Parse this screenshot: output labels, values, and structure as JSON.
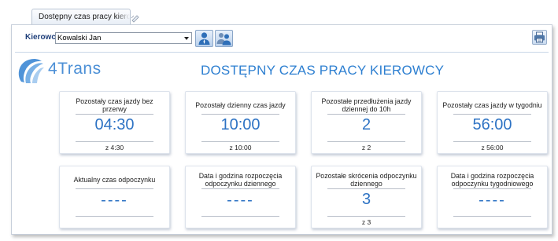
{
  "tab": {
    "label": "Dostępny czas pracy kierowcy"
  },
  "toolbar": {
    "driver_label": "Kierowca",
    "driver_value": "Kowalski Jan"
  },
  "brand": {
    "name": "4Trans"
  },
  "page": {
    "title": "DOSTĘPNY CZAS PRACY KIEROWCY"
  },
  "cards": [
    {
      "label": "Pozostały czas jazdy bez przerwy",
      "value": "04:30",
      "sub": "z 4:30"
    },
    {
      "label": "Pozostały dzienny czas jazdy",
      "value": "10:00",
      "sub": "z 10:00"
    },
    {
      "label": "Pozostałe przedłużenia jazdy dziennej do 10h",
      "value": "2",
      "sub": "z 2"
    },
    {
      "label": "Pozostały czas jazdy w tygodniu",
      "value": "56:00",
      "sub": "z 56:00"
    },
    {
      "label": "Aktualny czas odpoczynku",
      "value": "----",
      "sub": ""
    },
    {
      "label": "Data i godzina rozpoczęcia odpoczynku dziennego",
      "value": "----",
      "sub": ""
    },
    {
      "label": "Pozostałe skrócenia odpoczynku dziennego",
      "value": "3",
      "sub": "z 3"
    },
    {
      "label": "Data i godzina rozpoczęcia odpoczynku tygodniowego",
      "value": "----",
      "sub": ""
    }
  ],
  "icons": {
    "driver_button": "single-driver-icon",
    "drivers_button": "multiple-drivers-icon",
    "print_button": "printer-icon",
    "new_tab": "new-tab-icon"
  },
  "colors": {
    "accent": "#2e73c4",
    "title": "#2f80d1",
    "label": "#1f3f7a"
  }
}
